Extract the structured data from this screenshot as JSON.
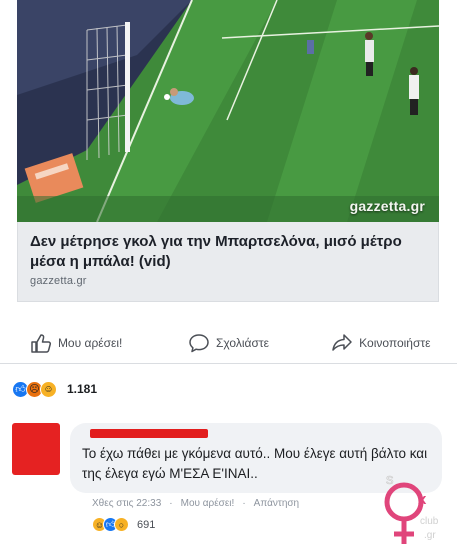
{
  "post": {
    "photo": {
      "brand": "gazzetta.gr",
      "scene": "soccer-goal-photo"
    },
    "link": {
      "title": "Δεν μέτρησε γκολ για την Μπαρτσελόνα, μισό μέτρο μέσα η μπάλα! (vid)",
      "domain": "gazzetta.gr"
    },
    "actions": [
      {
        "label": "Μου αρέσει!",
        "icon": "thumbs-up-icon"
      },
      {
        "label": "Σχολιάστε",
        "icon": "comment-icon"
      },
      {
        "label": "Κοινοποιήστε",
        "icon": "share-icon"
      }
    ],
    "reactions": {
      "types": [
        "like",
        "angry",
        "haha"
      ],
      "count": "1.181"
    }
  },
  "comment": {
    "text": "Το έχω πάθει με γκόμενα αυτό.. Μου έλεγε αυτή βάλτο και της έλεγα εγώ Μ'ΕΣΑ Ε'ΙΝΑΙ..",
    "time": "Χθες στις 22:33",
    "like_action": "Μου αρέσει!",
    "reply_action": "Απάντηση",
    "separator": "·",
    "reactions": {
      "types": [
        "haha",
        "like",
        "wow"
      ],
      "count": "691"
    }
  },
  "watermark": {
    "text": "sex club .gr"
  },
  "colors": {
    "facebook_blue": "#1877f2",
    "redaction_red": "#e21d1d",
    "pitch_green": "#3f8a3a",
    "watermark_pink": "#e0457b"
  }
}
